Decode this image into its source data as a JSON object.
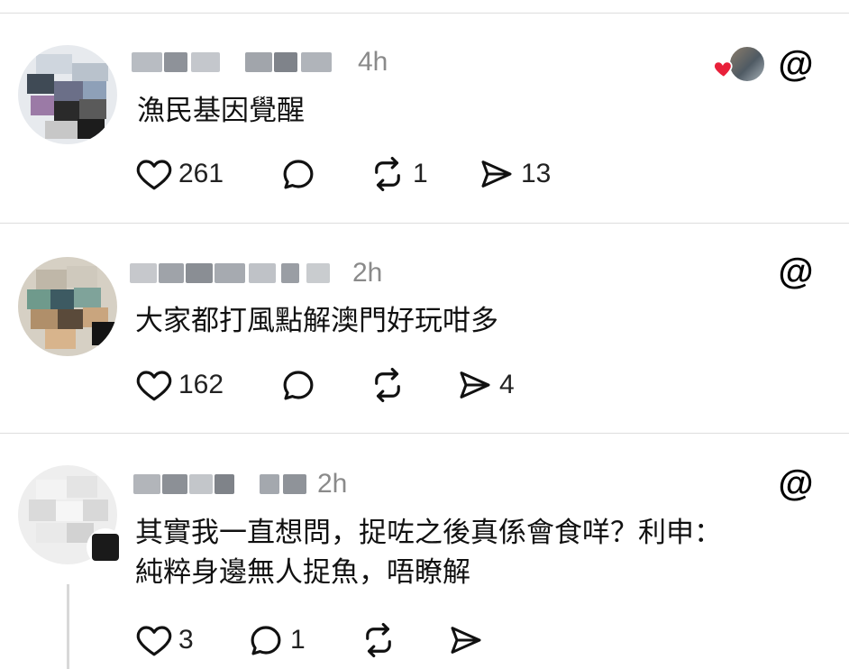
{
  "posts": [
    {
      "time": "4h",
      "text": [
        "漁民基因覺醒"
      ],
      "likes": "261",
      "replies": "",
      "reposts": "1",
      "shares": "13"
    },
    {
      "time": "2h",
      "text": [
        "大家都打風點解澳門好玩咁多"
      ],
      "likes": "162",
      "replies": "",
      "reposts": "",
      "shares": "4"
    },
    {
      "time": "2h",
      "text": [
        "其實我一直想問，捉咗之後真係會食咩？利申：",
        "純粹身邊無人捉魚，唔瞭解"
      ],
      "likes": "3",
      "replies": "1",
      "reposts": "",
      "shares": ""
    }
  ],
  "icons": {
    "like": "heart-outline-icon",
    "reply": "speech-bubble-icon",
    "repost": "repost-arrows-icon",
    "share": "paper-plane-icon",
    "app": "threads-logo-icon",
    "liked_by": "red-heart-icon"
  },
  "colors": {
    "divider": "#dedede",
    "meta_text": "#8a8a8a",
    "liked_heart": "#e8203a"
  }
}
